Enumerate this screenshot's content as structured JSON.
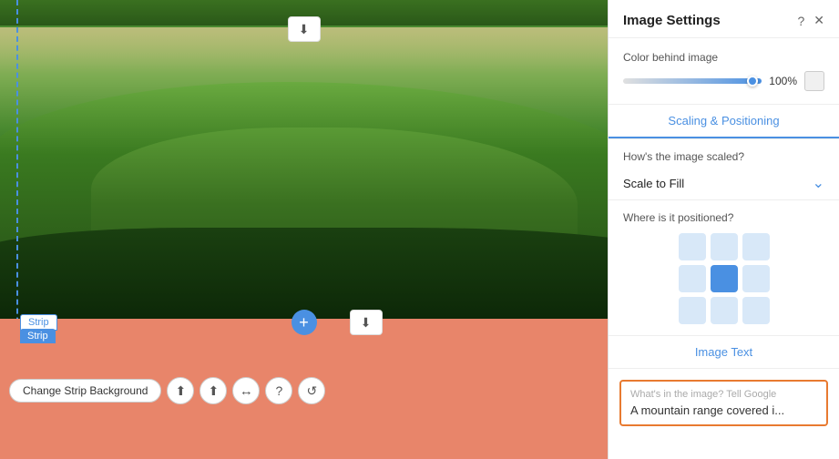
{
  "canvas": {
    "top_download_tooltip": "Download",
    "add_button_label": "+",
    "strip_label_1": "Strip",
    "strip_label_2": "Strip"
  },
  "toolbar": {
    "change_bg_label": "Change Strip Background",
    "icons": [
      "⬆",
      "⬆",
      "↔",
      "?",
      "↺"
    ]
  },
  "panel": {
    "title": "Image Settings",
    "help_icon": "?",
    "close_icon": "✕",
    "color_section": {
      "label": "Color behind image",
      "percent": "100%"
    },
    "tabs": {
      "scaling_label": "Scaling & Positioning",
      "image_text_label": "Image Text"
    },
    "scaling": {
      "how_scaled_label": "How's the image scaled?",
      "scale_value": "Scale to Fill",
      "where_positioned_label": "Where is it positioned?"
    },
    "position_grid": [
      [
        false,
        false,
        false
      ],
      [
        false,
        true,
        false
      ],
      [
        false,
        false,
        false
      ]
    ],
    "image_text": {
      "hint": "What's in the image? Tell Google",
      "value": "A mountain range covered i..."
    }
  }
}
